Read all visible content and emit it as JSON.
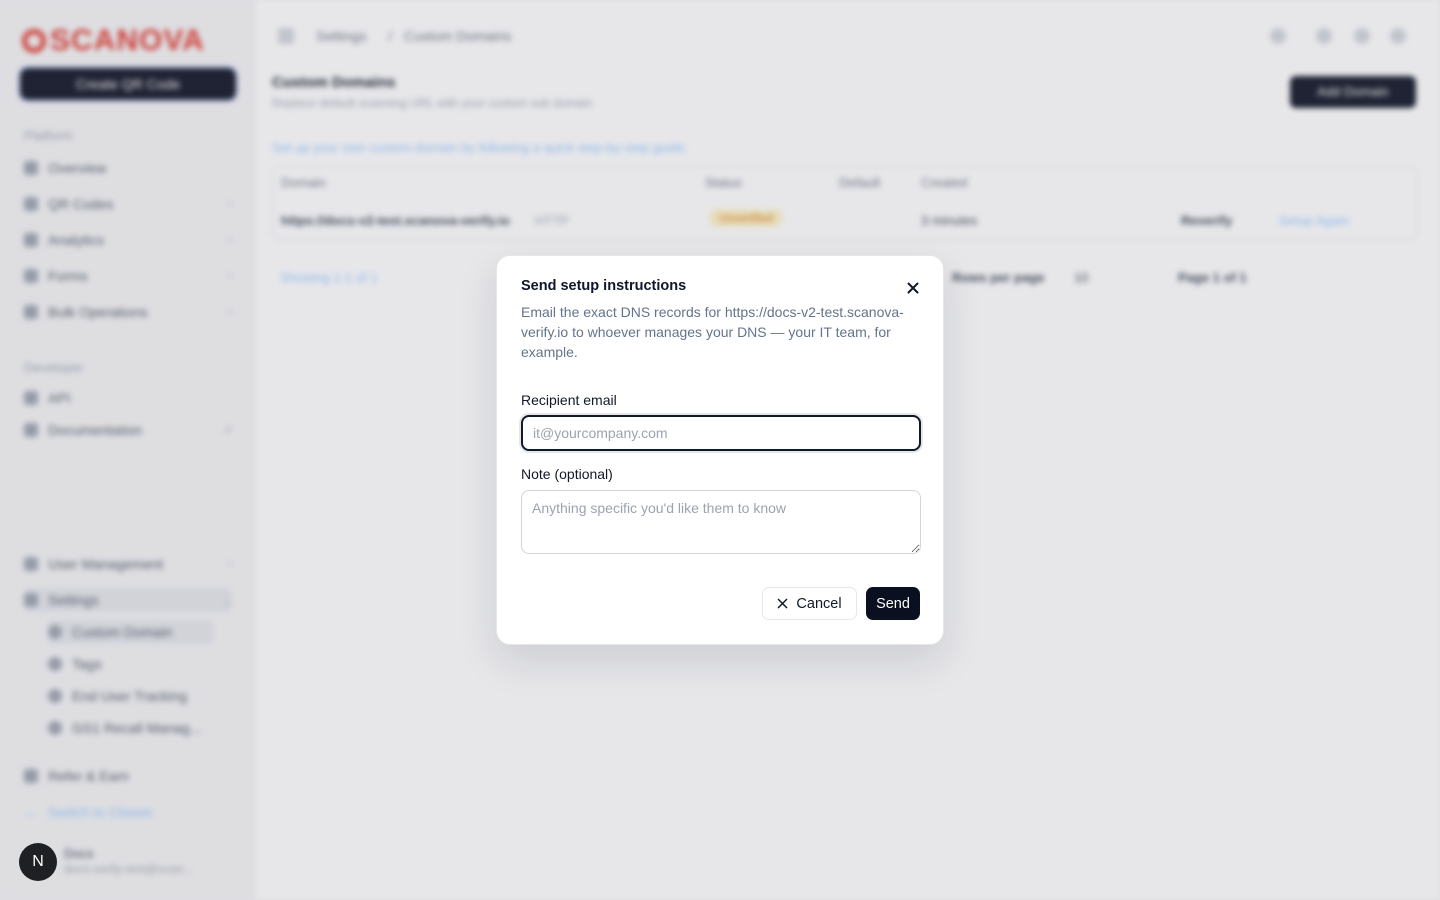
{
  "background": {
    "logo": "SCANOVA",
    "create_button": "Create QR Code",
    "sections": {
      "platform": "Platform",
      "developer": "Developer"
    },
    "nav": [
      "Overview",
      "QR Codes",
      "Analytics",
      "Forms",
      "Bulk Operations",
      "API",
      "Documentation",
      "User Management",
      "Settings"
    ],
    "settings_sub": [
      "Custom Domain",
      "Tags",
      "End User Tracking",
      "GS1 Recall Manag..."
    ],
    "bottom": [
      "Refer & Earn",
      "Switch to Classic"
    ],
    "user": {
      "initial": "N",
      "name": "Docs",
      "email": "docs-verify-test@scan..."
    },
    "breadcrumb": [
      "Settings",
      "Custom Domains"
    ],
    "page_title": "Custom Domains",
    "page_subtitle": "Replace default scanning URL with your custom sub domain",
    "add_button": "Add Domain",
    "guide": "Set up your own custom domain by following a quick step-by-step guide.",
    "table": {
      "headers": [
        "Domain",
        "Status",
        "Default",
        "Created"
      ],
      "row": {
        "domain": "https://docs-v2-test.scanova-verify.io",
        "tag": "HTTP",
        "status": "Unverified",
        "created": "3 minutes",
        "verify": "Reverify",
        "setup": "Setup Again"
      }
    },
    "footer": {
      "showing": "Showing 1-1 of 1",
      "rows_label": "Rows per page",
      "rows_value": "10",
      "page": "Page 1 of 1"
    }
  },
  "dialog": {
    "title": "Send setup instructions",
    "description": "Email the exact DNS records for https://docs-v2-test.scanova-verify.io to whoever manages your DNS — your IT team, for example.",
    "email_label": "Recipient email",
    "email_placeholder": "it@yourcompany.com",
    "email_value": "",
    "note_label": "Note (optional)",
    "note_placeholder": "Anything specific you'd like them to know",
    "cancel_label": "Cancel",
    "send_label": "Send"
  }
}
